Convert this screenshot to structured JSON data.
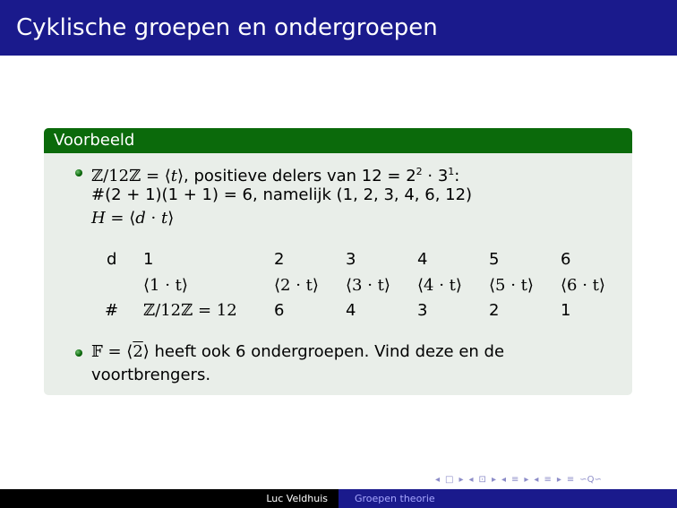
{
  "slide": {
    "title": "Cyklische groepen en ondergroepen",
    "block_title": "Voorbeeld"
  },
  "bullet1": {
    "line1_part1": "ℤ/12ℤ = ⟨",
    "line1_t": "t",
    "line1_part2": "⟩, positieve delers van 12 = 2",
    "line1_exp1": "2",
    "line1_part3": " · 3",
    "line1_exp2": "1",
    "line1_part4": ":",
    "line2": "#(2 + 1)(1 + 1) = 6, namelijk (1, 2, 3, 4, 6, 12)",
    "line3_h": "H",
    "line3_part1": " = ⟨",
    "line3_d": "d",
    "line3_part2": " · ",
    "line3_t": "t",
    "line3_part3": "⟩"
  },
  "table": {
    "row_d_label": "d",
    "row_hash_label": "#",
    "columns": [
      {
        "d": "1",
        "gen": "⟨1 · t⟩",
        "count": "ℤ/12ℤ = 12"
      },
      {
        "d": "2",
        "gen": "⟨2 · t⟩",
        "count": "6"
      },
      {
        "d": "3",
        "gen": "⟨3 · t⟩",
        "count": "4"
      },
      {
        "d": "4",
        "gen": "⟨4 · t⟩",
        "count": "3"
      },
      {
        "d": "5",
        "gen": "⟨5 · t⟩",
        "count": "2"
      },
      {
        "d": "6",
        "gen": "⟨6 · t⟩",
        "count": "1"
      }
    ]
  },
  "bullet2": {
    "line1_part1": "𝔽 = ⟨",
    "line1_gen": "2",
    "line1_part2": "⟩ heeft ook 6 ondergroepen. Vind deze en de",
    "line2": "voortbrengers."
  },
  "footer": {
    "author": "Luc Veldhuis",
    "talk": "Groepen theorie"
  },
  "nav": {
    "frame_prev": "◂",
    "frame_icon": "□",
    "frame_next": "▸",
    "sub_prev": "◂",
    "sub_icon": "⊡",
    "sub_next": "▸",
    "sec_prev": "◂",
    "sec_icon": "≡",
    "sec_next": "▸",
    "subsec_prev": "◂",
    "subsec_icon": "≡",
    "subsec_next": "▸",
    "align": "≡",
    "search": "∽Q∽"
  }
}
